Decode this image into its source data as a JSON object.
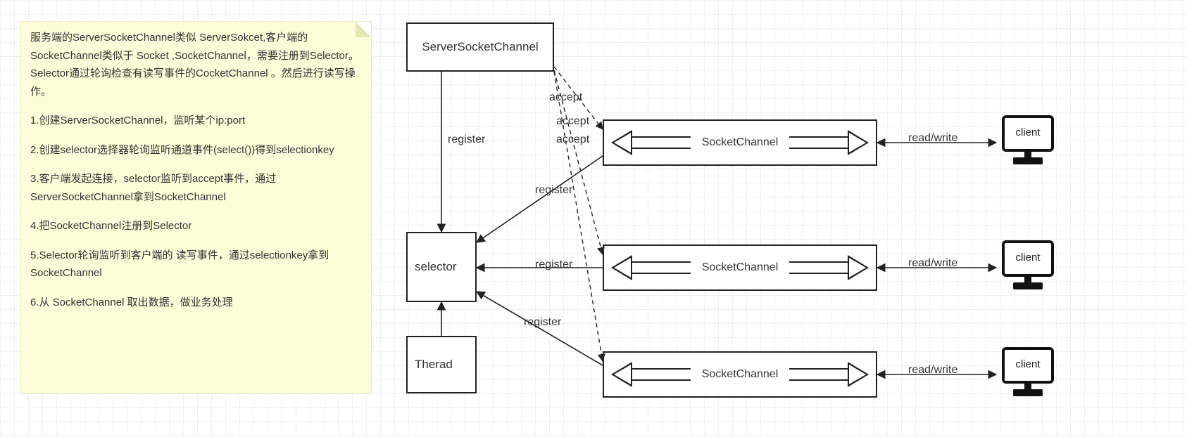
{
  "note": {
    "intro": "服务端的ServerSocketChannel类似 ServerSokcet,客户端的SocketChannel类似于 Socket ,SocketChannel，需要注册到Selector。Selector通过轮询检查有读写事件的CocketChannel 。然后进行读写操作。",
    "steps": [
      "1.创建ServerSocketChannel，监听某个ip:port",
      "2.创建selector选择器轮询监听通道事件(select())得到selectionkey",
      "3.客户端发起连接，selector监听到accept事件，通过ServerSocketChannel拿到SocketChannel",
      "4.把SocketChannel注册到Selector",
      "5.Selector轮询监听到客户端的 读写事件，通过selectionkey拿到SocketChannel",
      "6.从 SocketChannel 取出数据，做业务处理"
    ]
  },
  "nodes": {
    "server_socket_channel": "ServerSocketChannel",
    "selector": "selector",
    "thread": "Therad",
    "socket_channel": "SocketChannel",
    "client": "client"
  },
  "edges": {
    "register": "register",
    "accept": "accept",
    "read_write": "read/write"
  }
}
